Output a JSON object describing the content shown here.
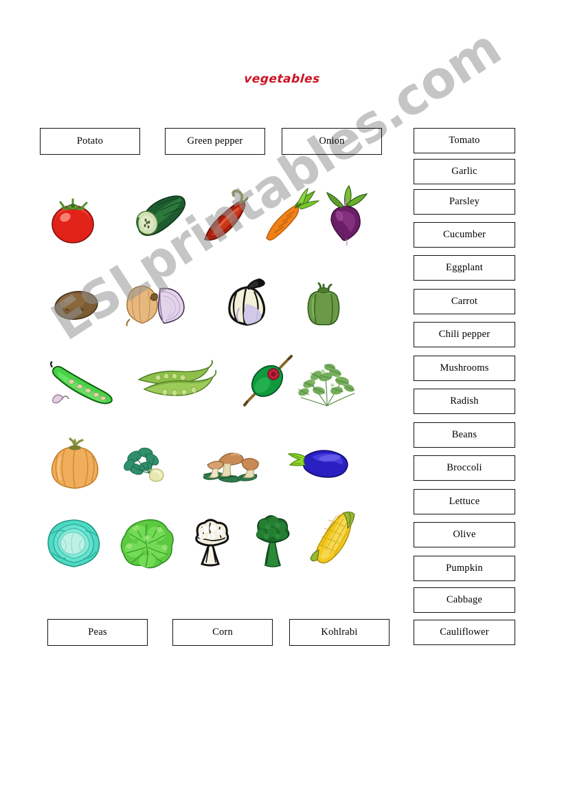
{
  "page": {
    "title": "vegetables",
    "title_color": "#cc1122",
    "background": "#ffffff",
    "watermark": "ESLprintables.com",
    "watermark_color": "#969696",
    "border_color": "#111111"
  },
  "top_row": {
    "labels": [
      {
        "text": "Potato"
      },
      {
        "text": "Green pepper"
      },
      {
        "text": "Onion"
      }
    ]
  },
  "bottom_row": {
    "labels": [
      {
        "text": "Peas"
      },
      {
        "text": "Corn"
      },
      {
        "text": "Kohlrabi"
      }
    ]
  },
  "right_column": {
    "labels": [
      {
        "text": "Tomato"
      },
      {
        "text": "Garlic"
      },
      {
        "text": "Parsley"
      },
      {
        "text": "Cucumber"
      },
      {
        "text": "Eggplant"
      },
      {
        "text": "Carrot"
      },
      {
        "text": "Chili pepper"
      },
      {
        "text": "Mushrooms"
      },
      {
        "text": "Radish"
      },
      {
        "text": "Beans"
      },
      {
        "text": "Broccoli"
      },
      {
        "text": "Lettuce"
      },
      {
        "text": "Olive"
      },
      {
        "text": "Pumpkin"
      },
      {
        "text": "Cabbage"
      },
      {
        "text": "Cauliflower"
      }
    ]
  },
  "pictures": {
    "rows": [
      {
        "items": [
          {
            "name": "tomato",
            "colors": {
              "body": "#e02219",
              "shade": "#a8120c",
              "leaf": "#4f8f2a"
            }
          },
          {
            "name": "cucumber",
            "colors": {
              "body": "#1d5c2e",
              "shade": "#123d1e",
              "flesh": "#cfe0b4"
            }
          },
          {
            "name": "chili-pepper",
            "colors": {
              "body": "#a8200f",
              "shade": "#6d1508",
              "stem": "#8a8f3a"
            }
          },
          {
            "name": "carrot",
            "colors": {
              "body": "#f08019",
              "shade": "#c75e08",
              "leaf": "#6fbb2a"
            }
          },
          {
            "name": "radish",
            "colors": {
              "body": "#6b1e66",
              "shade": "#43103f",
              "leaf": "#5f9e2b"
            }
          }
        ]
      },
      {
        "items": [
          {
            "name": "potato",
            "colors": {
              "body": "#7a5b33",
              "shade": "#4d3820"
            }
          },
          {
            "name": "onion",
            "colors": {
              "body": "#e7b87e",
              "shade": "#c08f52",
              "half": "#d8c6e0"
            }
          },
          {
            "name": "garlic",
            "colors": {
              "body": "#f2f0d8",
              "shade": "#cfc6e8",
              "outline": "#111111"
            }
          },
          {
            "name": "green-pepper",
            "colors": {
              "body": "#6a9a45",
              "shade": "#3f6b28",
              "stem": "#3f6b28"
            }
          }
        ]
      },
      {
        "items": [
          {
            "name": "beans",
            "colors": {
              "body": "#49d249",
              "shade": "#1f8f24",
              "seed": "#d6d6a8"
            }
          },
          {
            "name": "peas",
            "colors": {
              "body": "#8cc04a",
              "shade": "#5d8c2c",
              "seed": "#c9e08a"
            }
          },
          {
            "name": "olive",
            "colors": {
              "body": "#0f9a3e",
              "shade": "#0a6b2b",
              "pimento": "#c21f3a",
              "pick": "#8a6a2a"
            }
          },
          {
            "name": "parsley",
            "colors": {
              "body": "#6aa84f",
              "shade": "#3d7030"
            }
          }
        ]
      },
      {
        "items": [
          {
            "name": "pumpkin",
            "colors": {
              "body": "#f0ad5c",
              "shade": "#d18a30",
              "stem": "#8a8f3a"
            }
          },
          {
            "name": "kohlrabi",
            "colors": {
              "body": "#e8e8b0",
              "leaf": "#2f8f6a",
              "shade": "#1f6b4d"
            }
          },
          {
            "name": "mushrooms",
            "colors": {
              "cap": "#c98a55",
              "stem": "#e8dcb4",
              "leaf": "#2f7a4a"
            }
          },
          {
            "name": "eggplant",
            "colors": {
              "body": "#2a1fc0",
              "shade": "#150f7a",
              "stem": "#8fd62a"
            }
          }
        ]
      },
      {
        "items": [
          {
            "name": "cabbage",
            "colors": {
              "body": "#4ed9c4",
              "shade": "#22a894",
              "inner": "#bff0e6"
            }
          },
          {
            "name": "lettuce",
            "colors": {
              "body": "#5cc940",
              "shade": "#2f8f25"
            }
          },
          {
            "name": "cauliflower",
            "colors": {
              "body": "#f4efdf",
              "shade": "#ffffff",
              "outline": "#111111"
            }
          },
          {
            "name": "broccoli",
            "colors": {
              "body": "#1a6b2a",
              "shade": "#0f4a1c"
            }
          },
          {
            "name": "corn",
            "colors": {
              "body": "#f2c91e",
              "shade": "#c79d0c",
              "husk": "#9ab832"
            }
          }
        ]
      }
    ]
  }
}
